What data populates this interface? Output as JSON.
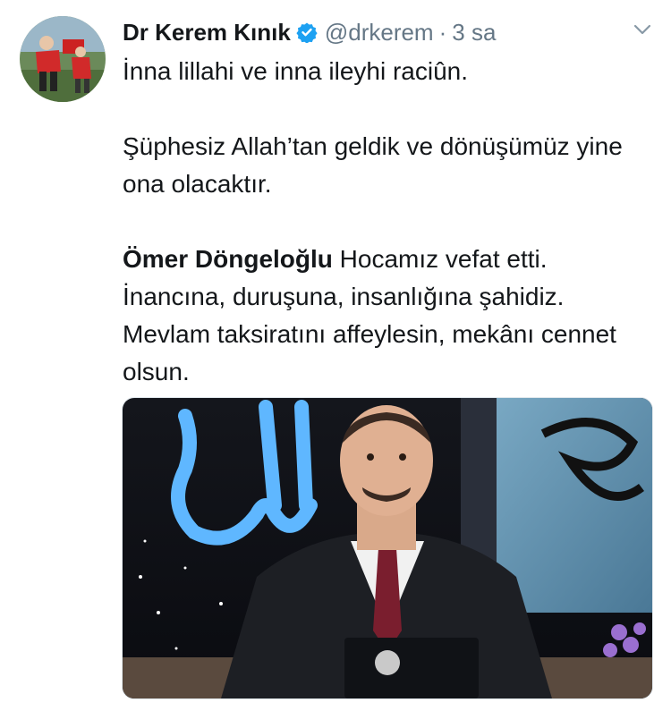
{
  "tweet": {
    "author_name": "Dr Kerem Kınık",
    "handle": "@drkerem",
    "separator": "·",
    "time": "3 sa",
    "line1": "İnna lillahi ve inna ileyhi raciûn.",
    "line2": "Şüphesiz Allah’tan geldik ve dönüşümüz yine ona olacaktır.",
    "line3_bold": "Ömer Döngeloğlu",
    "line3_rest": " Hocamız vefat etti. İnancına, duruşuna, insanlığına şahidiz. Mevlam taksiratını affeylesin, mekânı cennet olsun."
  },
  "icons": {
    "verified": "verified-badge-icon",
    "more": "chevron-down-icon"
  },
  "colors": {
    "name": "#14171a",
    "secondary": "#657786",
    "verified": "#1da1f2",
    "background": "#ffffff"
  }
}
